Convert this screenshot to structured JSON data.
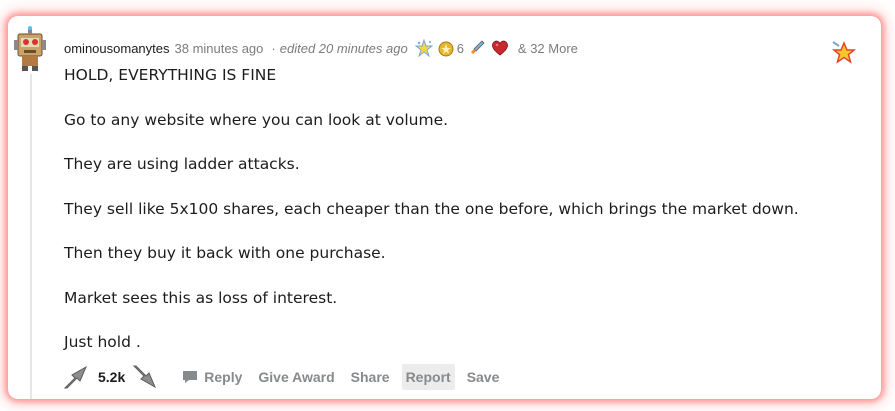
{
  "comment": {
    "username": "ominousomanytes",
    "time": "38 minutes ago",
    "separator": "·",
    "edited": "edited 20 minutes ago",
    "award_count": "6",
    "more_awards": "& 32 More",
    "paragraphs": [
      "HOLD, EVERYTHING IS FINE",
      "Go to any website where you can look at volume.",
      "They are using ladder attacks.",
      "They sell like 5x100 shares, each cheaper than the one before, which brings the market down.",
      "Then they buy it back with one purchase.",
      "Market sees this as loss of interest.",
      "Just hold ."
    ]
  },
  "actions": {
    "score": "5.2k",
    "reply": "Reply",
    "give_award": "Give Award",
    "share": "Share",
    "report": "Report",
    "save": "Save"
  },
  "icons": {
    "avatar": "robot-avatar-icon",
    "award_1": "silver-star-award-icon",
    "award_2": "gold-medal-award-icon",
    "award_3": "rocket-award-icon",
    "award_4": "heart-award-icon",
    "corner": "gold-star-award-icon",
    "upvote": "rocket-upvote-icon",
    "downvote": "rocket-downvote-icon",
    "reply": "comment-bubble-icon"
  },
  "colors": {
    "glow": "#ff5a5a",
    "text": "#1c1c1c",
    "meta": "#7c7c7c",
    "action": "#878a8c"
  }
}
